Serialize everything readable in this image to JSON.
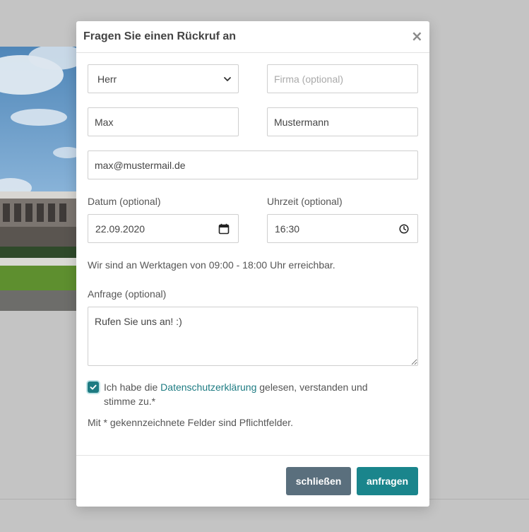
{
  "modal": {
    "title": "Fragen Sie einen Rückruf an",
    "close_glyph": "×"
  },
  "form": {
    "salutation": {
      "selected": "Herr"
    },
    "company": {
      "value": "",
      "placeholder": "Firma (optional)"
    },
    "first_name": {
      "value": "Max"
    },
    "last_name": {
      "value": "Mustermann"
    },
    "email": {
      "value": "max@mustermail.de"
    },
    "date": {
      "label": "Datum (optional)",
      "value": "22.09.2020",
      "icon": "calendar-icon"
    },
    "time": {
      "label": "Uhrzeit (optional)",
      "value": "16:30",
      "icon": "clock-icon"
    },
    "availability_text": "Wir sind an Werktagen von 09:00 - 18:00 Uhr erreichbar.",
    "request": {
      "label": "Anfrage (optional)",
      "value": "Rufen Sie uns an! :)"
    },
    "consent": {
      "checked": true,
      "prefix": "Ich habe die ",
      "link_text": "Datenschutzerklärung",
      "suffix": " gelesen, verstanden und stimme zu.*"
    },
    "required_note": "Mit * gekennzeichnete Felder sind Pflichtfelder."
  },
  "footer": {
    "close_label": "schließen",
    "submit_label": "anfragen"
  },
  "colors": {
    "accent": "#1a858c",
    "secondary": "#5a6f7d",
    "overlay": "#c4c4c4"
  }
}
